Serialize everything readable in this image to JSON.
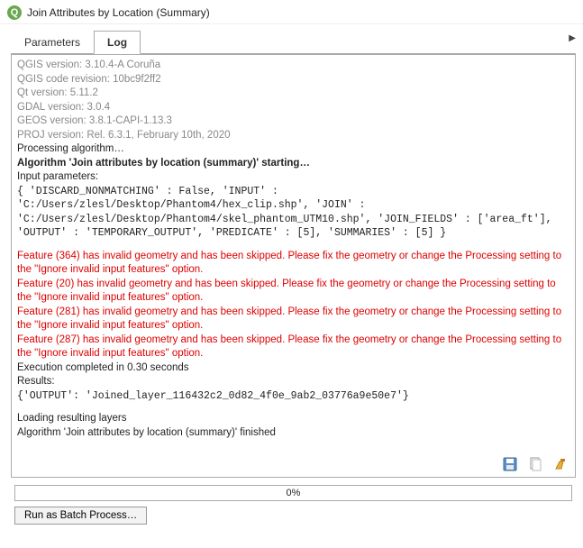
{
  "window": {
    "title": "Join Attributes by Location (Summary)"
  },
  "tabs": {
    "parameters": "Parameters",
    "log": "Log",
    "active": "log"
  },
  "log": {
    "version_lines": [
      "QGIS version: 3.10.4-A Coruña",
      "QGIS code revision: 10bc9f2ff2",
      "Qt version: 5.11.2",
      "GDAL version: 3.0.4",
      "GEOS version: 3.8.1-CAPI-1.13.3",
      "PROJ version: Rel. 6.3.1, February 10th, 2020"
    ],
    "processing": "Processing algorithm…",
    "alg_start": "Algorithm 'Join attributes by location (summary)' starting…",
    "input_header": "Input parameters:",
    "input_params": "{ 'DISCARD_NONMATCHING' : False, 'INPUT' : 'C:/Users/zlesl/Desktop/Phantom4/hex_clip.shp', 'JOIN' : 'C:/Users/zlesl/Desktop/Phantom4/skel_phantom_UTM10.shp', 'JOIN_FIELDS' : ['area_ft'], 'OUTPUT' : 'TEMPORARY_OUTPUT', 'PREDICATE' : [5], 'SUMMARIES' : [5] }",
    "errors": [
      "Feature (364) has invalid geometry and has been skipped. Please fix the geometry or change the Processing setting to the \"Ignore invalid input features\" option.",
      "Feature (20) has invalid geometry and has been skipped. Please fix the geometry or change the Processing setting to the \"Ignore invalid input features\" option.",
      "Feature (281) has invalid geometry and has been skipped. Please fix the geometry or change the Processing setting to the \"Ignore invalid input features\" option.",
      "Feature (287) has invalid geometry and has been skipped. Please fix the geometry or change the Processing setting to the \"Ignore invalid input features\" option."
    ],
    "exec_time": "Execution completed in 0.30 seconds",
    "results_header": "Results:",
    "results_body": "{'OUTPUT': 'Joined_layer_116432c2_0d82_4f0e_9ab2_03776a9e50e7'}",
    "loading": "Loading resulting layers",
    "finished": "Algorithm 'Join attributes by location (summary)' finished"
  },
  "progress": {
    "text": "0%"
  },
  "buttons": {
    "batch": "Run as Batch Process…"
  }
}
